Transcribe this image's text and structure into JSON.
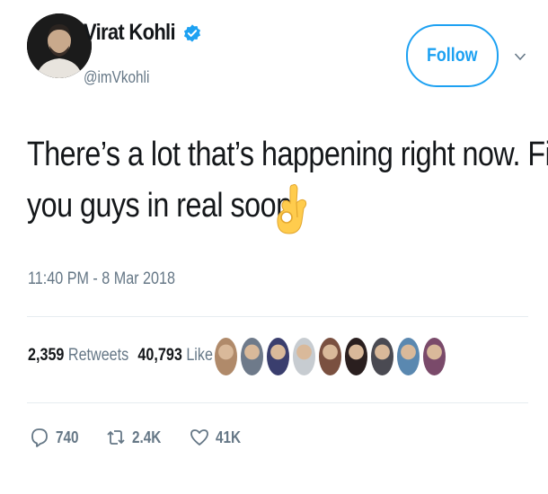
{
  "author": {
    "name": "Virat Kohli",
    "handle": "@imVkohli",
    "verified": true
  },
  "follow": {
    "label": "Follow"
  },
  "tweet": {
    "line1": "There’s a lot that’s happening right now. Fill",
    "line2": "you guys in real soon!",
    "emoji": "ok-hand-emoji",
    "timestamp": "11:40 PM - 8 Mar 2018"
  },
  "stats": {
    "retweets_count": "2,359",
    "retweets_label": "Retweets",
    "likes_count": "40,793",
    "likes_label": "Likes"
  },
  "actions": {
    "reply_count": "740",
    "retweet_count": "2.4K",
    "like_count": "41K"
  },
  "colors": {
    "accent": "#1da1f2",
    "muted": "#657786",
    "text": "#14171a",
    "divider": "#e6ecf0"
  },
  "liker_avatar_colors": [
    "#b08a6a",
    "#6e7a8a",
    "#3a3e6e",
    "#c7ccd1",
    "#7a5040",
    "#2a1f1f",
    "#4a4a52",
    "#5a88b0",
    "#7a4a6a"
  ]
}
